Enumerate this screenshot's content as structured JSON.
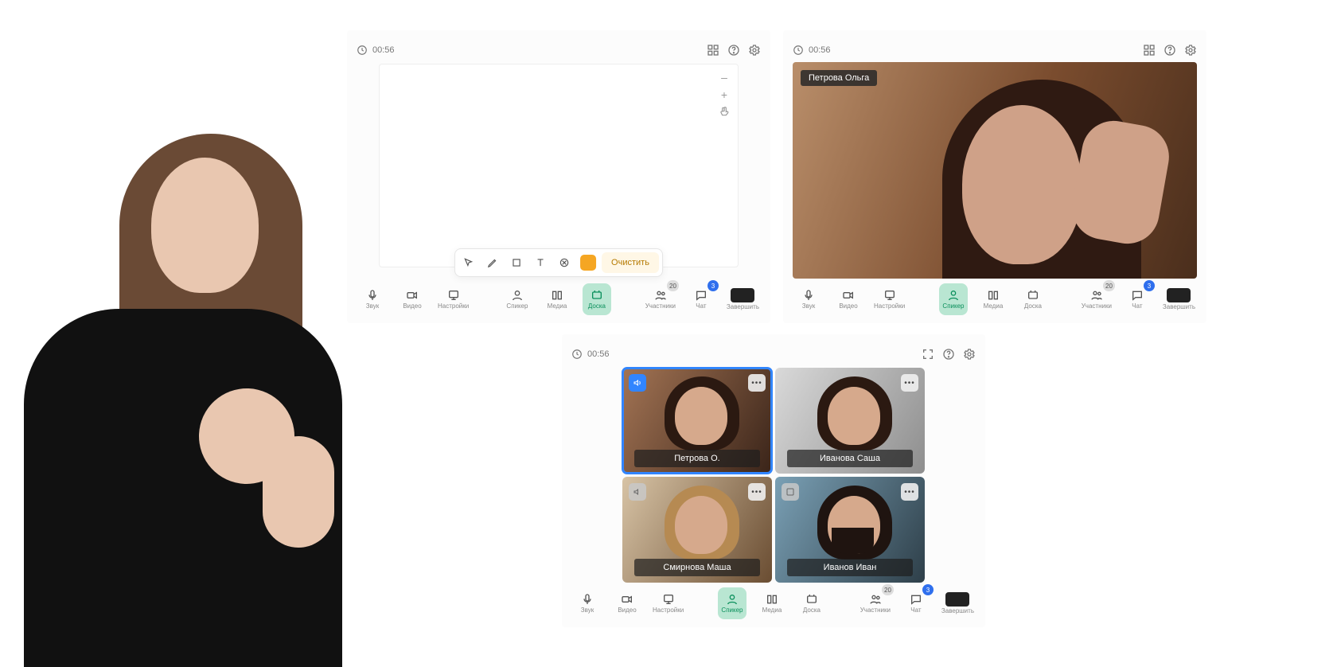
{
  "panel1": {
    "time": "00:56",
    "whiteboard": {
      "tools": {
        "minus": "–",
        "plus": "+",
        "hand": "hand"
      },
      "clear_label": "Очистить",
      "color": "#f5a623"
    },
    "controls": {
      "left": [
        {
          "key": "audio",
          "label": "Звук"
        },
        {
          "key": "video",
          "label": "Видео"
        },
        {
          "key": "settings",
          "label": "Настройки"
        }
      ],
      "center": [
        {
          "key": "speaker",
          "label": "Спикер"
        },
        {
          "key": "media",
          "label": "Медиа"
        },
        {
          "key": "board",
          "label": "Доска",
          "active": true
        }
      ],
      "right": [
        {
          "key": "participants",
          "label": "Участники",
          "badge": "20"
        },
        {
          "key": "chat",
          "label": "Чат",
          "badge": "3"
        },
        {
          "key": "end",
          "label": "Завершить"
        }
      ]
    }
  },
  "panel2": {
    "time": "00:56",
    "speaker_name": "Петрова Ольга",
    "controls": {
      "left": [
        {
          "key": "audio",
          "label": "Звук"
        },
        {
          "key": "video",
          "label": "Видео"
        },
        {
          "key": "settings",
          "label": "Настройки"
        }
      ],
      "center": [
        {
          "key": "speaker",
          "label": "Спикер",
          "active": true
        },
        {
          "key": "media",
          "label": "Медиа"
        },
        {
          "key": "board",
          "label": "Доска"
        }
      ],
      "right": [
        {
          "key": "participants",
          "label": "Участники",
          "badge": "20"
        },
        {
          "key": "chat",
          "label": "Чат",
          "badge": "3"
        },
        {
          "key": "end",
          "label": "Завершить"
        }
      ]
    }
  },
  "panel3": {
    "time": "00:56",
    "tiles": [
      {
        "name": "Петрова О.",
        "speaking": true
      },
      {
        "name": "Иванова Саша",
        "speaking": false
      },
      {
        "name": "Смирнова Маша",
        "speaking": false
      },
      {
        "name": "Иванов Иван",
        "speaking": false
      }
    ],
    "controls": {
      "left": [
        {
          "key": "audio",
          "label": "Звук"
        },
        {
          "key": "video",
          "label": "Видео"
        },
        {
          "key": "settings",
          "label": "Настройки"
        }
      ],
      "center": [
        {
          "key": "speaker",
          "label": "Спикер",
          "active": true
        },
        {
          "key": "media",
          "label": "Медиа"
        },
        {
          "key": "board",
          "label": "Доска"
        }
      ],
      "right": [
        {
          "key": "participants",
          "label": "Участники",
          "badge": "20"
        },
        {
          "key": "chat",
          "label": "Чат",
          "badge": "3"
        },
        {
          "key": "end",
          "label": "Завершить"
        }
      ]
    }
  }
}
